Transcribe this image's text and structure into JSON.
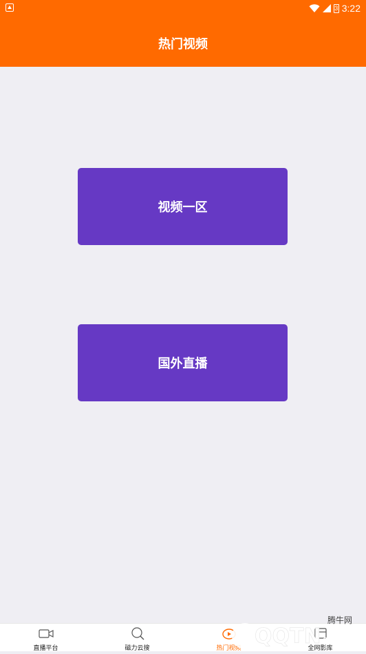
{
  "status_bar": {
    "time": "3:22",
    "battery_level": "3",
    "icons": [
      "app-notification-icon",
      "wifi-icon",
      "signal-icon",
      "battery-icon"
    ]
  },
  "header": {
    "title": "热门视频"
  },
  "main": {
    "buttons": [
      {
        "label": "视频一区"
      },
      {
        "label": "国外直播"
      }
    ]
  },
  "tabbar": {
    "tabs": [
      {
        "label": "直播平台",
        "icon": "video-camera-icon",
        "active": false
      },
      {
        "label": "磁力云搜",
        "icon": "search-icon",
        "active": false
      },
      {
        "label": "热门视频",
        "icon": "hot-video-icon",
        "active": true
      },
      {
        "label": "全网影库",
        "icon": "library-icon",
        "active": false
      }
    ]
  },
  "watermark": {
    "site_label": "腾牛网",
    "logo_text": "QQTN.com"
  },
  "colors": {
    "accent": "#ff6a00",
    "button": "#6639c4",
    "background": "#efeef3"
  }
}
